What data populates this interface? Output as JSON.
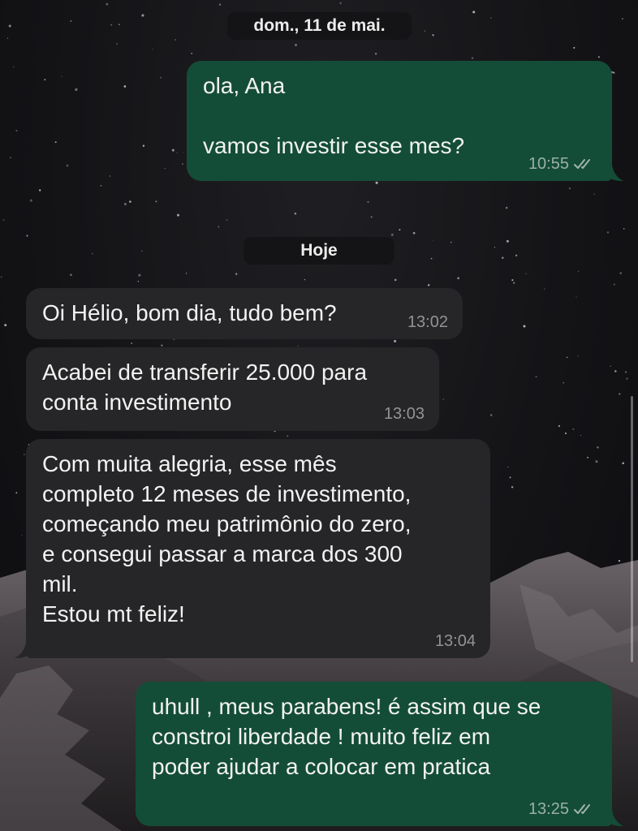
{
  "date_separators": {
    "previous": "dom., 11 de mai.",
    "today": "Hoje"
  },
  "messages": [
    {
      "direction": "outgoing",
      "text": "ola, Ana\n\nvamos investir esse mes?",
      "time": "10:55",
      "status": "read"
    },
    {
      "direction": "incoming",
      "text": "Oi Hélio, bom dia, tudo bem?",
      "time": "13:02"
    },
    {
      "direction": "incoming",
      "text": "Acabei de transferir 25.000 para\nconta investimento",
      "time": "13:03"
    },
    {
      "direction": "incoming",
      "text": "Com muita alegria, esse mês\ncompleto 12 meses de investimento,\ncomeçando meu patrimônio do zero,\ne consegui passar a marca dos 300\nmil.\nEstou mt feliz!",
      "time": "13:04"
    },
    {
      "direction": "outgoing",
      "text": "uhull , meus parabens! é assim que se\nconstroi liberdade ! muito feliz em\npoder ajudar a colocar em pratica",
      "time": "13:25",
      "status": "read"
    }
  ],
  "colors": {
    "outgoing_bubble": "#144d37",
    "incoming_bubble": "#262628",
    "date_pill": "#141416"
  },
  "icons": {
    "read_receipt": "double-check-icon"
  }
}
